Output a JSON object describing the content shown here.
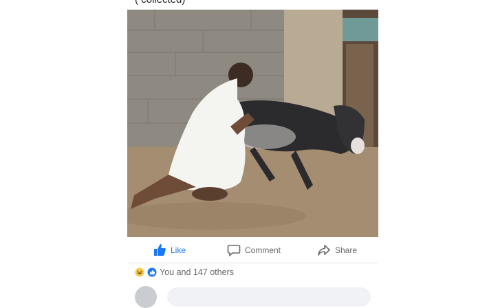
{
  "post": {
    "caption": "( collected)"
  },
  "actions": {
    "like_label": "Like",
    "comment_label": "Comment",
    "share_label": "Share"
  },
  "reactions": {
    "summary": "You and 147 others"
  },
  "colors": {
    "like_blue": "#1877f2",
    "muted_text": "#65676b",
    "divider": "#e4e6eb"
  }
}
